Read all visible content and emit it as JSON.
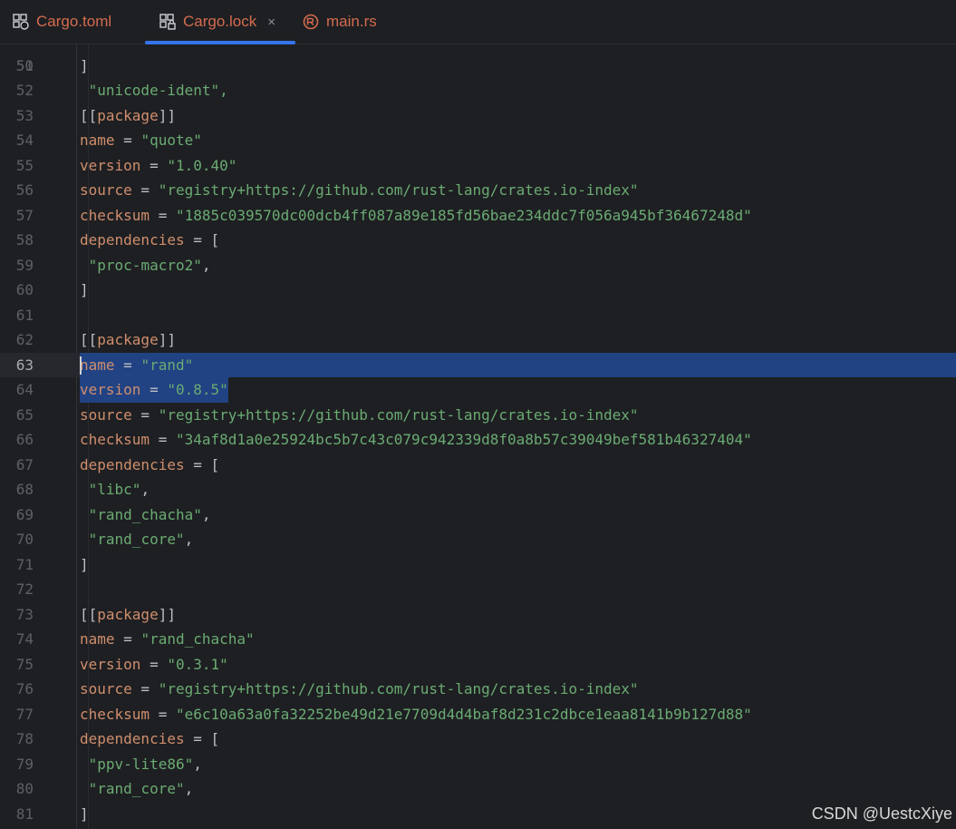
{
  "tabs": [
    {
      "label": "Cargo.toml",
      "icon": "toml-file-icon",
      "active": false
    },
    {
      "label": "Cargo.lock",
      "icon": "lock-file-icon",
      "active": true,
      "close": "×"
    },
    {
      "label": "main.rs",
      "icon": "rust-file-icon",
      "active": false
    }
  ],
  "colors": {
    "background": "#1e1f22",
    "keyword": "#cf8e6d",
    "string": "#6aab73",
    "selection": "#214283",
    "tab_accent": "#3574f0"
  },
  "editor": {
    "partial_top_line": {
      "ln": "50",
      "text": " \"unicode-ident\","
    },
    "current_line": "63",
    "lines": [
      {
        "ln": "51",
        "text": "]"
      },
      {
        "ln": "52",
        "text": ""
      },
      {
        "ln": "53",
        "text": "[[package]]"
      },
      {
        "ln": "54",
        "text": "name = \"quote\""
      },
      {
        "ln": "55",
        "text": "version = \"1.0.40\""
      },
      {
        "ln": "56",
        "text": "source = \"registry+https://github.com/rust-lang/crates.io-index\""
      },
      {
        "ln": "57",
        "text": "checksum = \"1885c039570dc00dcb4ff087a89e185fd56bae234ddc7f056a945bf36467248d\""
      },
      {
        "ln": "58",
        "text": "dependencies = ["
      },
      {
        "ln": "59",
        "text": " \"proc-macro2\","
      },
      {
        "ln": "60",
        "text": "]"
      },
      {
        "ln": "61",
        "text": ""
      },
      {
        "ln": "62",
        "text": "[[package]]"
      },
      {
        "ln": "63",
        "text": "name = \"rand\""
      },
      {
        "ln": "64",
        "text": "version = \"0.8.5\""
      },
      {
        "ln": "65",
        "text": "source = \"registry+https://github.com/rust-lang/crates.io-index\""
      },
      {
        "ln": "66",
        "text": "checksum = \"34af8d1a0e25924bc5b7c43c079c942339d8f0a8b57c39049bef581b46327404\""
      },
      {
        "ln": "67",
        "text": "dependencies = ["
      },
      {
        "ln": "68",
        "text": " \"libc\","
      },
      {
        "ln": "69",
        "text": " \"rand_chacha\","
      },
      {
        "ln": "70",
        "text": " \"rand_core\","
      },
      {
        "ln": "71",
        "text": "]"
      },
      {
        "ln": "72",
        "text": ""
      },
      {
        "ln": "73",
        "text": "[[package]]"
      },
      {
        "ln": "74",
        "text": "name = \"rand_chacha\""
      },
      {
        "ln": "75",
        "text": "version = \"0.3.1\""
      },
      {
        "ln": "76",
        "text": "source = \"registry+https://github.com/rust-lang/crates.io-index\""
      },
      {
        "ln": "77",
        "text": "checksum = \"e6c10a63a0fa32252be49d21e7709d4d4baf8d231c2dbce1eaa8141b9b127d88\""
      },
      {
        "ln": "78",
        "text": "dependencies = ["
      },
      {
        "ln": "79",
        "text": " \"ppv-lite86\","
      },
      {
        "ln": "80",
        "text": " \"rand_core\","
      },
      {
        "ln": "81",
        "text": "]"
      }
    ]
  },
  "watermark": "CSDN @UestcXiye"
}
